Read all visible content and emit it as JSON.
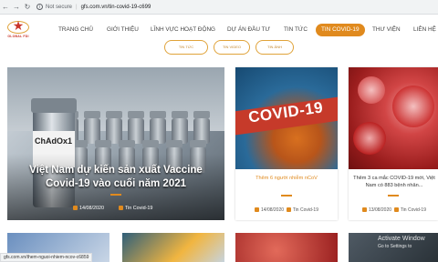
{
  "browser": {
    "security_label": "Not secure",
    "url": "gfs.com.vn/tin-covid-19-c699"
  },
  "logo": {
    "text": "GLOBAL FDI"
  },
  "menu": [
    {
      "label": "TRANG CHỦ"
    },
    {
      "label": "GIỚI THIỆU"
    },
    {
      "label": "LĨNH VỰC HOẠT ĐỘNG"
    },
    {
      "label": "DỰ ÁN ĐẦU TƯ"
    },
    {
      "label": "TIN TỨC"
    },
    {
      "label": "TIN COVID-19",
      "active": true
    },
    {
      "label": "THƯ VIỆN"
    },
    {
      "label": "LIÊN HỆ"
    }
  ],
  "subtabs": [
    "TIN TỨC",
    "TIN VIDEO",
    "TIN ẢNH"
  ],
  "feature": {
    "title": "Việt Nam dự kiến sản xuất Vaccine Covid-19 vào cuối năm 2021",
    "date": "14/08/2020",
    "category": "Tin Covid-19",
    "vial_label": "ChAdOx1"
  },
  "cards": [
    {
      "title": "Thêm 6 người nhiễm nCoV",
      "date": "14/08/2020",
      "category": "Tin Covid-19",
      "image_text": "COVID-19"
    },
    {
      "title": "Thêm 3 ca mắc COVID-19 mới, Việt Nam có 883 bệnh nhân...",
      "date": "13/08/2020",
      "category": "Tin Covid-19"
    }
  ],
  "status_url": "gfs.com.vn/them-nguoi-nhiem-ncov-c6859",
  "watermark": {
    "line1": "Activate Window",
    "line2": "Go to Settings to"
  }
}
